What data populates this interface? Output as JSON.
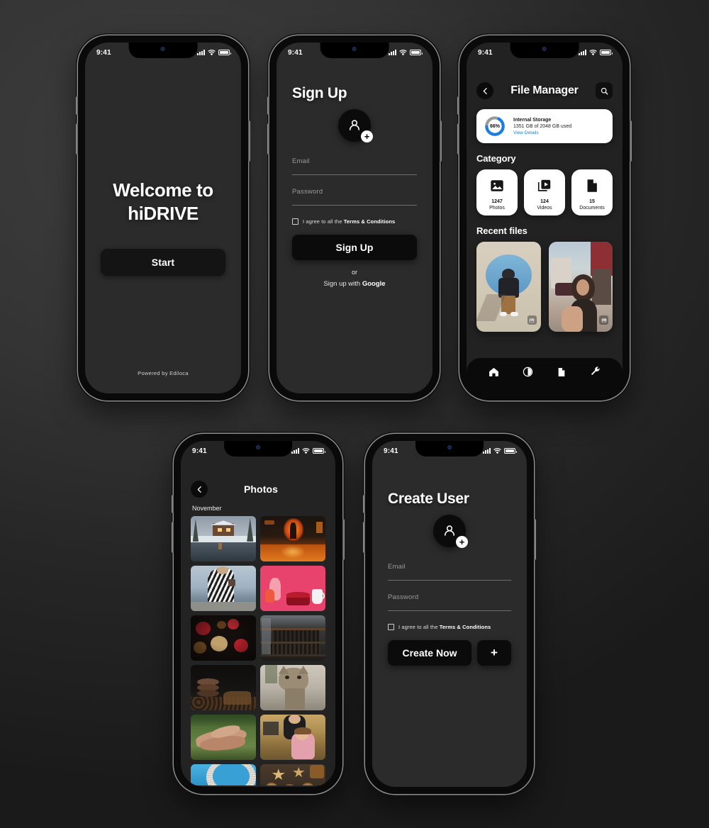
{
  "meta": {
    "app_name": "hiDRIVE",
    "accent_blue": "#1b7fe0",
    "card_white": "#ffffff",
    "screen_bg": "#2b2b2b",
    "button_black": "#0b0b0b"
  },
  "status_bar": {
    "time": "9:41",
    "signal_icon": "signal-bars-icon",
    "wifi_icon": "wifi-icon",
    "battery_icon": "battery-icon"
  },
  "screens": {
    "welcome": {
      "title_line1": "Welcome to",
      "title_line2": "hiDRIVE",
      "start_label": "Start",
      "footer": "Powered by Ediloca"
    },
    "signup": {
      "title": "Sign Up",
      "avatar_icon": "add-user-avatar-icon",
      "email_label": "Email",
      "email_value": "",
      "password_label": "Password",
      "password_value": "",
      "terms_prefix": "I agree to all the ",
      "terms_link": "Terms & Conditions",
      "submit_label": "Sign Up",
      "divider": "or",
      "google_prefix": "Sign up with ",
      "google_brand": "Google"
    },
    "file_manager": {
      "back_icon": "back-arrow-icon",
      "title": "File Manager",
      "search_icon": "search-icon",
      "storage": {
        "percent": "66%",
        "percent_value": 66,
        "name": "Internal Storage",
        "usage": "1351 GB of 2048 GB used",
        "link": "View Details"
      },
      "category_heading": "Category",
      "categories": [
        {
          "icon": "photo-icon",
          "count": "1247",
          "label": "Photos"
        },
        {
          "icon": "video-icon",
          "count": "124",
          "label": "Videos"
        },
        {
          "icon": "document-icon",
          "count": "15",
          "label": "Documents"
        }
      ],
      "recent_heading": "Recent files",
      "recent_files": [
        {
          "name": "recent-photo-1",
          "badge_icon": "image-badge-icon"
        },
        {
          "name": "recent-photo-2",
          "badge_icon": "image-badge-icon"
        }
      ],
      "nav_items": [
        {
          "icon": "home-icon",
          "name": "nav-home"
        },
        {
          "icon": "storage-chart-icon",
          "name": "nav-storage"
        },
        {
          "icon": "file-icon",
          "name": "nav-files"
        },
        {
          "icon": "wrench-icon",
          "name": "nav-tools"
        }
      ]
    },
    "photos": {
      "back_icon": "back-arrow-icon",
      "title": "Photos",
      "month": "November",
      "items": [
        {
          "name": "photo-cabin-snow"
        },
        {
          "name": "photo-neon-street"
        },
        {
          "name": "photo-striped-coat-lake"
        },
        {
          "name": "photo-pink-cake"
        },
        {
          "name": "photo-dark-berries"
        },
        {
          "name": "photo-bookshelf"
        },
        {
          "name": "photo-coffee-beans"
        },
        {
          "name": "photo-kitten"
        },
        {
          "name": "photo-hands"
        },
        {
          "name": "photo-children-hug"
        },
        {
          "name": "photo-blue-architecture"
        },
        {
          "name": "photo-baked-tarts"
        }
      ]
    },
    "create_user": {
      "title": "Create User",
      "avatar_icon": "add-user-avatar-icon",
      "email_label": "Email",
      "email_value": "",
      "password_label": "Password",
      "password_value": "",
      "terms_prefix": "I agree to all the ",
      "terms_link": "Terms & Conditions",
      "submit_label": "Create Now",
      "add_label": "+"
    }
  }
}
